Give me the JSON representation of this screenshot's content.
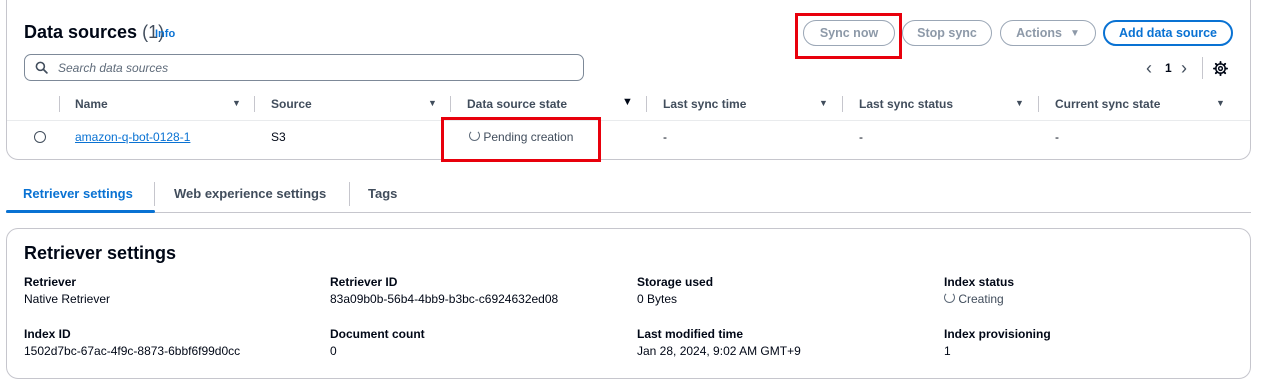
{
  "data_sources": {
    "title": "Data sources",
    "count": "(1)",
    "info": "Info",
    "search_placeholder": "Search data sources",
    "pagination": {
      "prev": "‹",
      "page": "1",
      "next": "›"
    },
    "buttons": {
      "sync_now": "Sync now",
      "stop_sync": "Stop sync",
      "actions": "Actions",
      "add_data_source": "Add data source"
    },
    "columns": [
      "Name",
      "Source",
      "Data source state",
      "Last sync time",
      "Last sync status",
      "Current sync state"
    ],
    "rows": [
      {
        "name": "amazon-q-bot-0128-1",
        "source": "S3",
        "state": "Pending creation",
        "last_sync_time": "-",
        "last_sync_status": "-",
        "current_sync_state": "-"
      }
    ]
  },
  "tabs": [
    {
      "label": "Retriever settings",
      "active": true
    },
    {
      "label": "Web experience settings",
      "active": false
    },
    {
      "label": "Tags",
      "active": false
    }
  ],
  "retriever": {
    "title": "Retriever settings",
    "fields": [
      {
        "label": "Retriever",
        "value": "Native Retriever"
      },
      {
        "label": "Retriever ID",
        "value": "83a09b0b-56b4-4bb9-b3bc-c6924632ed08"
      },
      {
        "label": "Storage used",
        "value": "0 Bytes"
      },
      {
        "label": "Index status",
        "value": "Creating"
      },
      {
        "label": "Index ID",
        "value": "1502d7bc-67ac-4f9c-8873-6bbf6f99d0cc"
      },
      {
        "label": "Document count",
        "value": "0"
      },
      {
        "label": "Last modified time",
        "value": "Jan 28, 2024, 9:02 AM GMT+9"
      },
      {
        "label": "Index provisioning",
        "value": "1"
      }
    ]
  },
  "colors": {
    "accent": "#0972d3",
    "highlight": "#e8000c",
    "border": "#c6c6cd"
  }
}
